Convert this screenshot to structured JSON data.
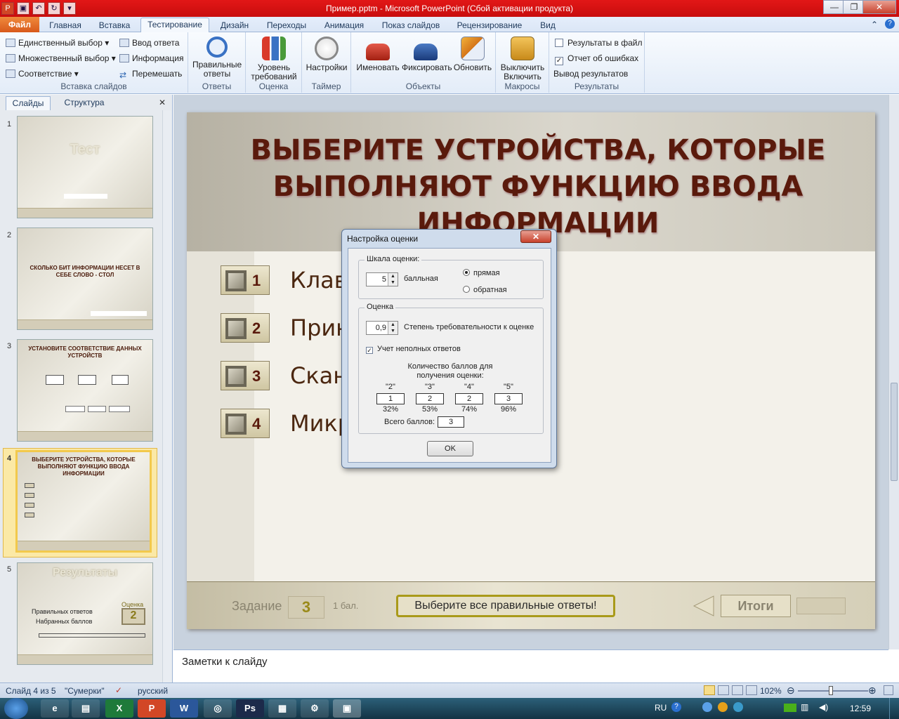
{
  "window": {
    "title": "Пример.pptm - Microsoft PowerPoint (Сбой активации продукта)"
  },
  "ribbon_tabs": [
    "Файл",
    "Главная",
    "Вставка",
    "Тестирование",
    "Дизайн",
    "Переходы",
    "Анимация",
    "Показ слайдов",
    "Рецензирование",
    "Вид"
  ],
  "ribbon": {
    "insert_group": {
      "single": "Единственный выбор",
      "multiple": "Множественный выбор",
      "match": "Соответствие",
      "answer": "Ввод ответа",
      "info": "Информация",
      "shuffle": "Перемешать",
      "label": "Вставка слайдов"
    },
    "answers_group": {
      "button": "Правильные ответы",
      "label": "Ответы"
    },
    "grade_group": {
      "button": "Уровень требований",
      "label": "Оценка"
    },
    "timer_group": {
      "button": "Настройки",
      "label": "Таймер"
    },
    "objects_group": {
      "rename": "Именовать",
      "fix": "Фиксировать",
      "refresh": "Обновить",
      "label": "Объекты"
    },
    "macros_group": {
      "button": "Выключить Включить",
      "label": "Макросы"
    },
    "results_group": {
      "to_file": "Результаты в файл",
      "errors": "Отчет об ошибках",
      "output": "Вывод результатов",
      "label": "Результаты"
    }
  },
  "left_panel": {
    "tabs": [
      "Слайды",
      "Структура"
    ],
    "slides": [
      {
        "num": "1",
        "title": "Тест"
      },
      {
        "num": "2",
        "title": "СКОЛЬКО БИТ ИНФОРМАЦИИ НЕСЕТ В СЕБЕ СЛОВО - СТОЛ"
      },
      {
        "num": "3",
        "title": "УСТАНОВИТЕ СООТВЕТСТВИЕ ДАННЫХ УСТРОЙСТВ"
      },
      {
        "num": "4",
        "title": "ВЫБЕРИТЕ УСТРОЙСТВА, КОТОРЫЕ ВЫПОЛНЯЮТ ФУНКЦИЮ ВВОДА ИНФОРМАЦИИ"
      },
      {
        "num": "5",
        "title": "Результаты"
      }
    ],
    "slide5": {
      "grade": "Оценка",
      "correct": "Правильных ответов",
      "scored": "Набранных баллов",
      "grade_value": "2"
    }
  },
  "slide": {
    "title": "ВЫБЕРИТЕ УСТРОЙСТВА, КОТОРЫЕ ВЫПОЛНЯЮТ ФУНКЦИЮ ВВОДА ИНФОРМАЦИИ",
    "options": [
      {
        "num": "1",
        "text": "Клав"
      },
      {
        "num": "2",
        "text": "Прин"
      },
      {
        "num": "3",
        "text": "Скан"
      },
      {
        "num": "4",
        "text": "Микр"
      }
    ],
    "footer": {
      "task_label": "Задание",
      "task_num": "3",
      "points": "1 бал.",
      "hint": "Выберите все правильные ответы!",
      "results": "Итоги"
    }
  },
  "dialog": {
    "title": "Настройка оценки",
    "close": "✕",
    "scale_legend": "Шкала оценки:",
    "scale_value": "5",
    "scale_unit": "балльная",
    "direct": "прямая",
    "reverse": "обратная",
    "grade_legend": "Оценка",
    "strict_value": "0,9",
    "strict_label": "Степень требовательности к оценке",
    "partial": "Учет неполных ответов",
    "points_header": "Количество баллов для получения оценки:",
    "grades": [
      {
        "mark": "\"2\"",
        "points": "1",
        "pct": "32%"
      },
      {
        "mark": "\"3\"",
        "points": "2",
        "pct": "53%"
      },
      {
        "mark": "\"4\"",
        "points": "2",
        "pct": "74%"
      },
      {
        "mark": "\"5\"",
        "points": "3",
        "pct": "96%"
      }
    ],
    "total_label": "Всего баллов:",
    "total_value": "3",
    "ok": "OK"
  },
  "notes": {
    "text": "Заметки к слайду"
  },
  "status": {
    "slide": "Слайд 4 из 5",
    "theme": "\"Сумерки\"",
    "lang": "русский",
    "zoom": "102%"
  },
  "taskbar": {
    "lang": "RU",
    "time": "12:59"
  }
}
